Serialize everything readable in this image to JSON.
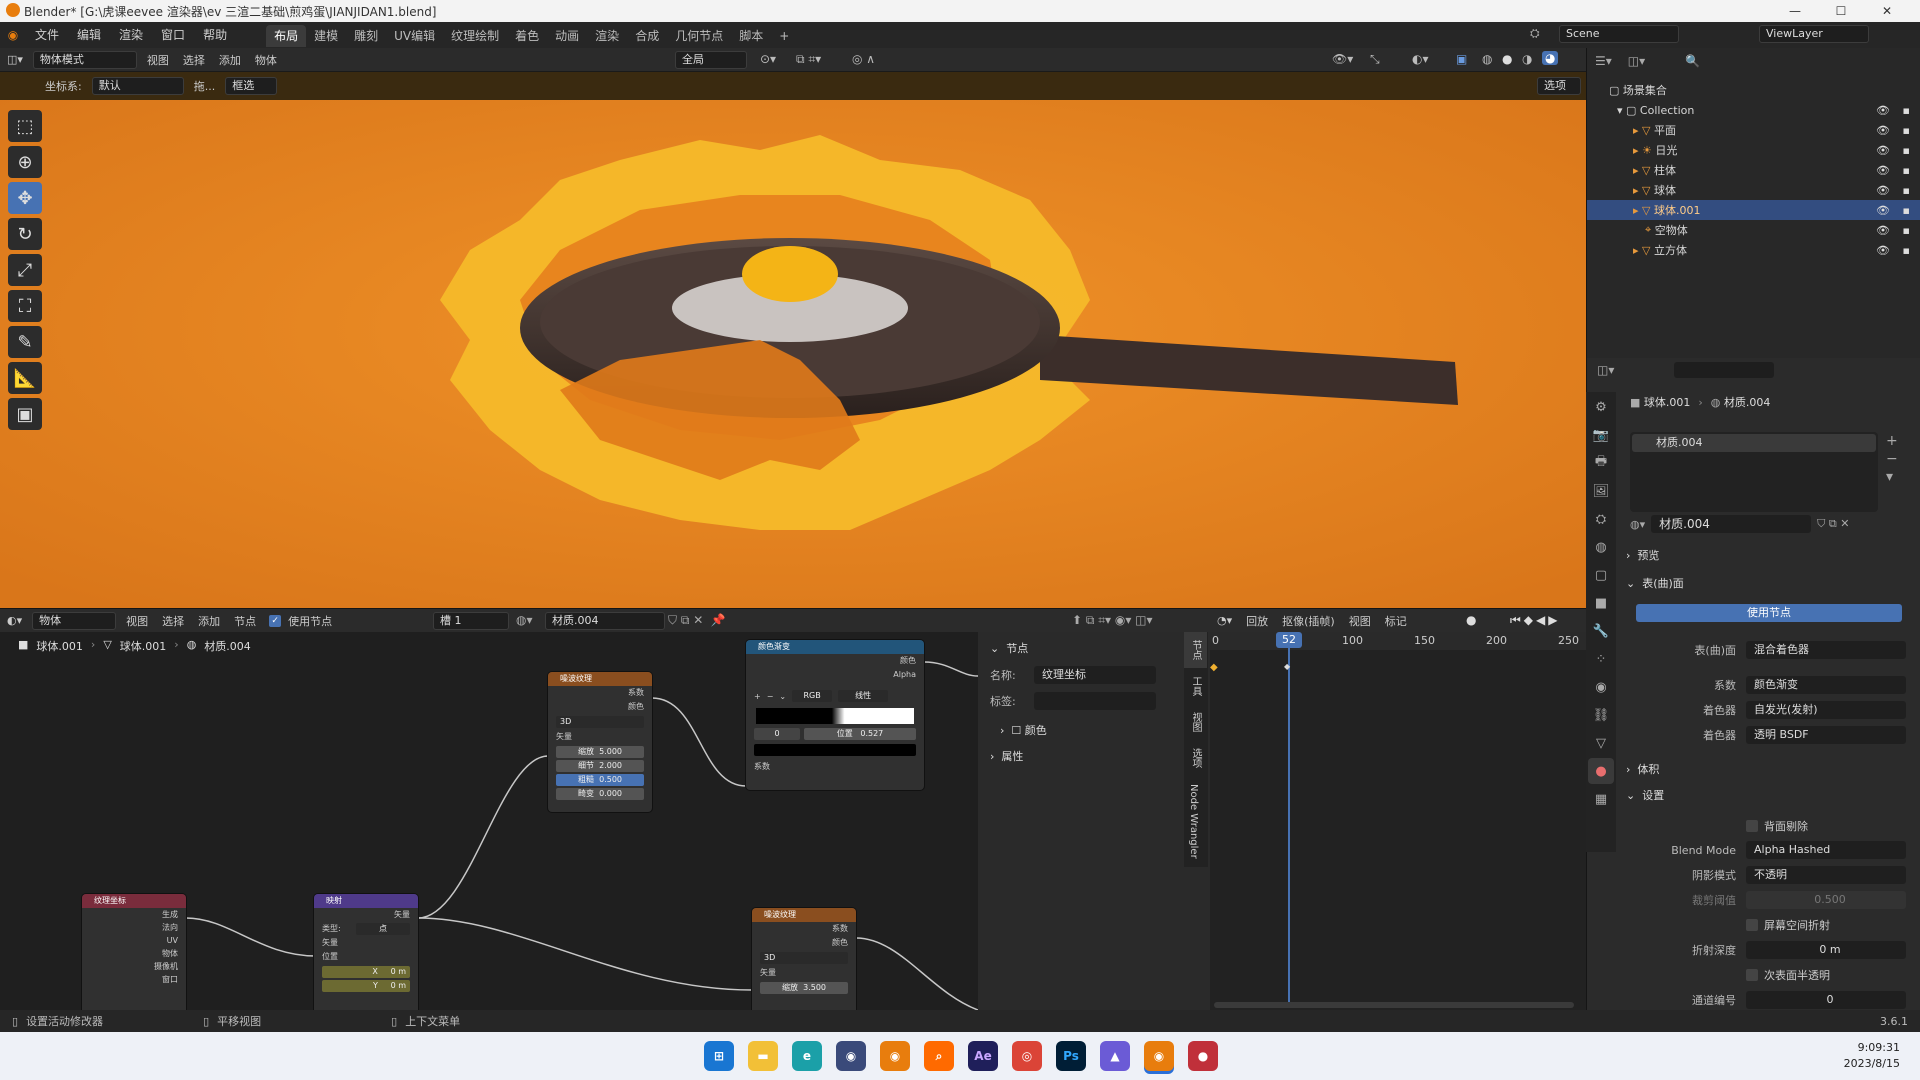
{
  "window": {
    "title": "Blender* [G:\\虎课eevee 渲染器\\ev 三渲二基础\\煎鸡蛋\\JIANJIDAN1.blend]"
  },
  "menu": [
    "文件",
    "编辑",
    "渲染",
    "窗口",
    "帮助"
  ],
  "workspaces": [
    "布局",
    "建模",
    "雕刻",
    "UV编辑",
    "纹理绘制",
    "着色",
    "动画",
    "渲染",
    "合成",
    "几何节点",
    "脚本"
  ],
  "scene": {
    "label": "Scene",
    "view_layer": "ViewLayer"
  },
  "viewport_header": {
    "mode": "物体模式",
    "items": [
      "视图",
      "选择",
      "添加",
      "物体"
    ],
    "transform": "全局"
  },
  "viewport_header2": {
    "coord_label": "坐标系:",
    "coord_value": "默认",
    "drag_label": "拖...",
    "drag_value": "框选",
    "options": "选项"
  },
  "outliner": {
    "root": "场景集合",
    "collection": "Collection",
    "items": [
      "平面",
      "日光",
      "柱体",
      "球体",
      "球体.001",
      "空物体",
      "立方体"
    ],
    "selected_index": 4
  },
  "properties": {
    "breadcrumb": [
      "球体.001",
      "材质.004"
    ],
    "material_slot": "材质.004",
    "material_name": "材质.004",
    "sections": {
      "preview": "预览",
      "surface": "表(曲)面",
      "volume": "体积",
      "settings": "设置"
    },
    "use_nodes": "使用节点",
    "surface_label": "表(曲)面",
    "surface_value": "混合着色器",
    "rows": [
      {
        "label": "系数",
        "value": "颜色渐变"
      },
      {
        "label": "着色器",
        "value": "自发光(发射)"
      },
      {
        "label": "着色器",
        "value": "透明 BSDF"
      }
    ],
    "backface": "背面剔除",
    "blend_mode_label": "Blend Mode",
    "blend_mode": "Alpha Hashed",
    "shadow_label": "阴影模式",
    "shadow_value": "不透明",
    "clip_label": "裁剪阈值",
    "clip_value": "0.500",
    "screen_refraction": "屏幕空间折射",
    "refraction_depth_label": "折射深度",
    "refraction_depth": "0 m",
    "subsurface": "次表面半透明",
    "pass_index_label": "通道编号",
    "pass_index": "0"
  },
  "node_editor_header": {
    "mode": "物体",
    "items": [
      "视图",
      "选择",
      "添加",
      "节点"
    ],
    "use_nodes": "使用节点",
    "slot": "槽 1",
    "material": "材质.004"
  },
  "node_breadcrumb": [
    "球体.001",
    "球体.001",
    "材质.004"
  ],
  "nodes": {
    "noise1": {
      "title": "噪波纹理",
      "out1": "系数",
      "out2": "颜色",
      "dim": "3D",
      "in": "矢量",
      "fields": [
        {
          "k": "缩放",
          "v": "5.000"
        },
        {
          "k": "细节",
          "v": "2.000"
        },
        {
          "k": "粗糙",
          "v": "0.500"
        },
        {
          "k": "畸变",
          "v": "0.000"
        }
      ]
    },
    "ramp": {
      "title": "颜色渐变",
      "out1": "颜色",
      "out2": "Alpha",
      "mode": "RGB",
      "interp": "线性",
      "pos_index": "0",
      "pos_label": "位置",
      "pos_value": "0.527",
      "in": "系数"
    },
    "texcoord": {
      "title": "纹理坐标",
      "outs": [
        "生成",
        "法向",
        "UV",
        "物体",
        "摄像机",
        "窗口"
      ]
    },
    "mapping": {
      "title": "映射",
      "out": "矢量",
      "type_label": "类型:",
      "type_value": "点",
      "in1": "矢量",
      "in2": "位置",
      "x": "0 m",
      "y": "0 m"
    },
    "noise2": {
      "title": "噪波纹理",
      "out1": "系数",
      "out2": "颜色",
      "dim": "3D",
      "in": "矢量",
      "field_k": "缩放",
      "field_v": "3.500"
    }
  },
  "node_sidebar": {
    "section": "节点",
    "name_label": "名称:",
    "name_value": "纹理坐标",
    "label_label": "标签:",
    "color": "颜色",
    "props": "属性",
    "tabs": [
      "节点",
      "工具",
      "视图",
      "选项",
      "Node Wrangler"
    ]
  },
  "timeline": {
    "header": [
      "回放",
      "抠像(插帧)",
      "视图",
      "标记"
    ],
    "current_frame": "52",
    "ticks": [
      "0",
      "50",
      "100",
      "150",
      "200",
      "250"
    ]
  },
  "status": {
    "left": "设置活动修改器",
    "mid": "平移视图",
    "right": "上下文菜单",
    "version": "3.6.1"
  },
  "taskbar": {
    "time": "9:09:31",
    "date": "2023/8/15"
  }
}
